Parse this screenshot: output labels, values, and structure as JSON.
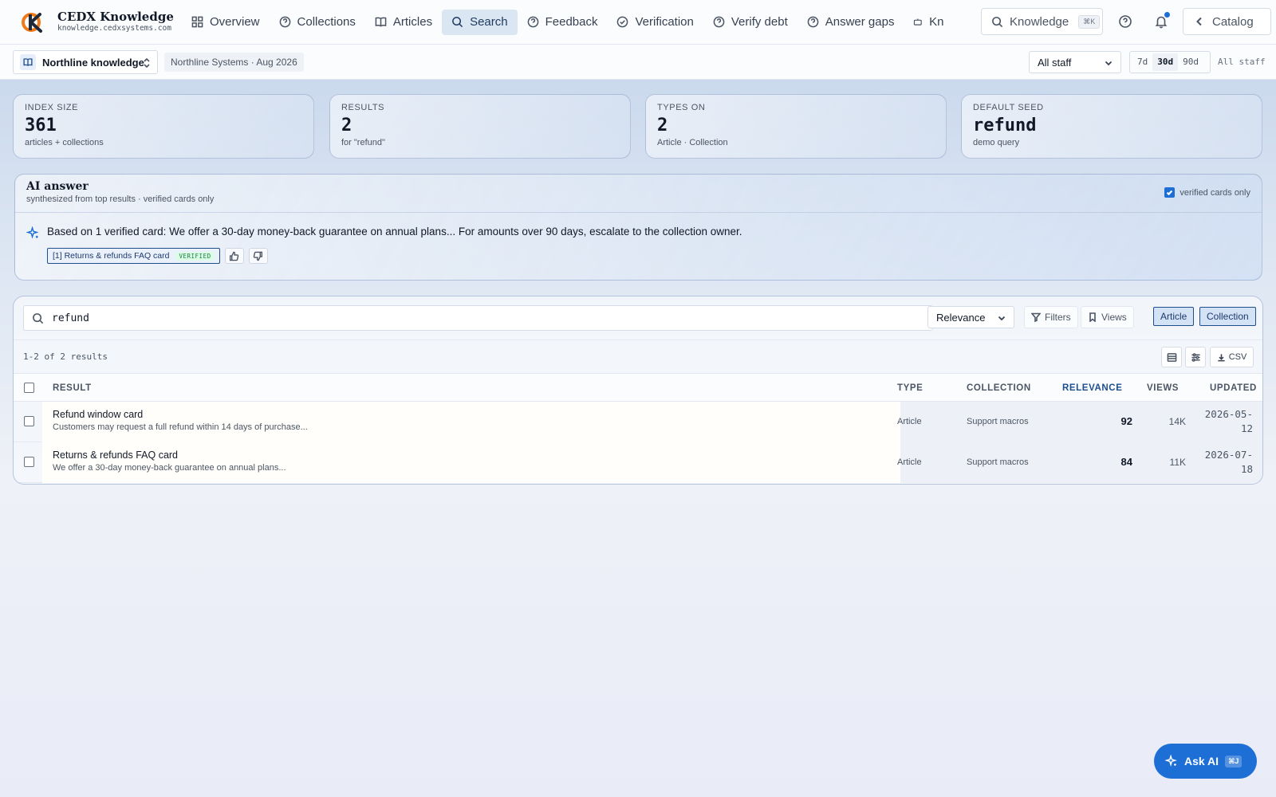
{
  "brand": {
    "name": "CEDX Knowledge",
    "url": "knowledge.cedxsystems.com"
  },
  "nav": {
    "items": [
      {
        "label": "Overview",
        "icon": "grid-icon"
      },
      {
        "label": "Collections",
        "icon": "help-circle-icon"
      },
      {
        "label": "Articles",
        "icon": "book-icon"
      },
      {
        "label": "Search",
        "icon": "search-icon",
        "active": true
      },
      {
        "label": "Feedback",
        "icon": "help-circle-icon"
      },
      {
        "label": "Verification",
        "icon": "check-circle-icon"
      },
      {
        "label": "Verify debt",
        "icon": "help-circle-icon"
      },
      {
        "label": "Answer gaps",
        "icon": "help-circle-icon"
      },
      {
        "label": "Kn",
        "icon": "robot-icon"
      }
    ]
  },
  "knowledge_search": {
    "label": "Knowledge",
    "shortcut": "⌘K"
  },
  "catalog": {
    "label": "Catalog"
  },
  "workspace": {
    "name": "Northline knowledge",
    "org_tag": "Northline Systems · Aug 2026"
  },
  "audience": {
    "selected": "All staff"
  },
  "ranges": [
    {
      "label": "7d"
    },
    {
      "label": "30d",
      "active": true
    },
    {
      "label": "90d"
    }
  ],
  "scope_label": "All staff",
  "stats": [
    {
      "label": "INDEX SIZE",
      "value": "361",
      "sub": "articles + collections",
      "mono": true
    },
    {
      "label": "RESULTS",
      "value": "2",
      "sub": "for \"refund\""
    },
    {
      "label": "TYPES ON",
      "value": "2",
      "sub": "Article · Collection"
    },
    {
      "label": "DEFAULT SEED",
      "value": "refund",
      "sub": "demo query",
      "mono": true
    }
  ],
  "ai_answer": {
    "title": "AI answer",
    "subtitle": "synthesized from top results · verified cards only",
    "verified_only_label": "verified cards only",
    "verified_only": true,
    "text": "Based on 1 verified card: We offer a 30-day money-back guarantee on annual plans... For amounts over 90 days, escalate to the collection owner.",
    "citation": "[1] Returns & refunds FAQ card",
    "citation_badge": "VERIFIED"
  },
  "search": {
    "query": "refund",
    "sort": "Relevance",
    "filters_label": "Filters",
    "views_label": "Views",
    "type_chips": [
      "Article",
      "Collection"
    ],
    "count_label": "1-2 of 2 results",
    "csv_label": "CSV"
  },
  "table": {
    "headers": {
      "result": "RESULT",
      "type": "TYPE",
      "collection": "COLLECTION",
      "relevance": "RELEVANCE",
      "views": "VIEWS",
      "updated": "UPDATED"
    },
    "rows": [
      {
        "title": "Refund window card",
        "desc": "Customers may request a full refund within 14 days of purchase...",
        "type": "Article",
        "collection": "Support macros",
        "relevance": "92",
        "views": "14K",
        "updated_1": "2026-05-",
        "updated_2": "12"
      },
      {
        "title": "Returns & refunds FAQ card",
        "desc": "We offer a 30-day money-back guarantee on annual plans...",
        "type": "Article",
        "collection": "Support macros",
        "relevance": "84",
        "views": "11K",
        "updated_1": "2026-07-",
        "updated_2": "18"
      }
    ]
  },
  "ask_ai": {
    "label": "Ask AI",
    "shortcut": "⌘J"
  },
  "colors": {
    "accent": "#1d6fd6",
    "nav_active_bg": "#dbe6f3",
    "verified": "#15803d"
  }
}
